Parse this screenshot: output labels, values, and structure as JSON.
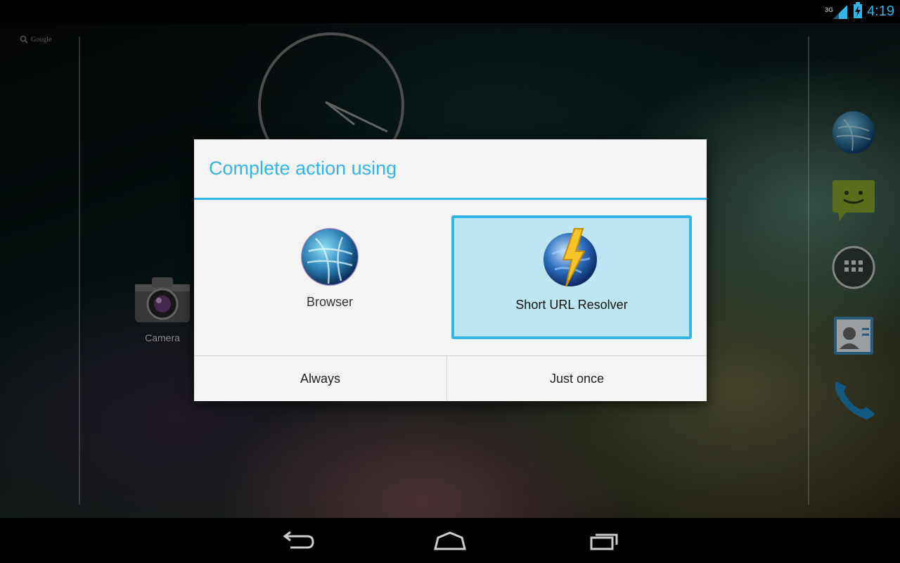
{
  "status_bar": {
    "time": "4:19",
    "network_type": "3G",
    "icons": [
      "signal-icon",
      "battery-charging-icon"
    ]
  },
  "home": {
    "search_label": "Google",
    "camera_label": "Camera",
    "dock_icons": [
      "browser-icon",
      "messaging-icon",
      "all-apps-icon",
      "people-icon",
      "phone-icon"
    ]
  },
  "dialog": {
    "title": "Complete action using",
    "options": [
      {
        "label": "Browser",
        "icon": "browser-globe-icon",
        "selected": false
      },
      {
        "label": "Short URL Resolver",
        "icon": "short-url-resolver-icon",
        "selected": true
      }
    ],
    "buttons": {
      "always": "Always",
      "just_once": "Just once"
    }
  },
  "nav_bar": {
    "buttons": [
      "back-icon",
      "home-icon",
      "recent-apps-icon"
    ]
  },
  "colors": {
    "accent": "#33b5e5",
    "selected_bg": "#bde5f2",
    "dialog_bg": "#f4f4f4"
  }
}
